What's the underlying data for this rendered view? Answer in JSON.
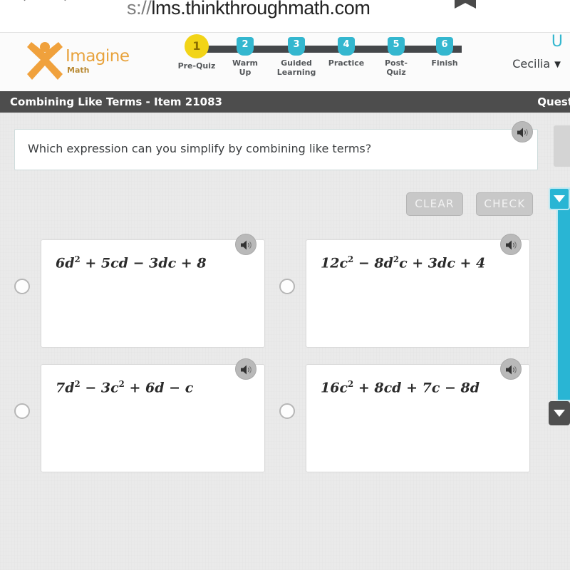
{
  "browser": {
    "url_dim": "s://",
    "url_main": "lms.thinkthroughmath.com",
    "left_glyphs": "← →",
    "bookmark_icon": "bookmark-icon"
  },
  "nav": {
    "logo_name": "Imagine",
    "logo_sub": "Math",
    "logo_icon": "imagine-math-x-logo",
    "user_initial": "U",
    "user_name": "Cecilia",
    "user_caret": "▼",
    "steps": [
      {
        "number": "1",
        "label": "Pre-Quiz",
        "state": "active"
      },
      {
        "number": "2",
        "label": "Warm Up",
        "state": "upcoming"
      },
      {
        "number": "3",
        "label": "Guided Learning",
        "state": "upcoming"
      },
      {
        "number": "4",
        "label": "Practice",
        "state": "upcoming"
      },
      {
        "number": "5",
        "label": "Post-Quiz",
        "state": "upcoming"
      },
      {
        "number": "6",
        "label": "Finish",
        "state": "upcoming"
      }
    ]
  },
  "title_bar": {
    "lesson_title": "Combining Like Terms - Item 21083",
    "question_counter": "Quest"
  },
  "question": {
    "prompt": "Which expression can you simplify by combining like terms?",
    "speaker_icon": "speaker-icon"
  },
  "actions": {
    "clear_label": "CLEAR",
    "check_label": "CHECK",
    "disabled": true
  },
  "options": [
    {
      "id": "A",
      "expr_html": "6<i>d</i><sup>2</sup> + 5<i>cd</i> − 3<i>dc</i> + 8",
      "expr_text": "6d^2 + 5cd - 3dc + 8",
      "selected": false
    },
    {
      "id": "B",
      "expr_html": "12<i>c</i><sup>2</sup> − 8<i>d</i><sup>2</sup><i>c</i> + 3<i>dc</i> + 4",
      "expr_text": "12c^2 - 8d^2c + 3dc + 4",
      "selected": false
    },
    {
      "id": "C",
      "expr_html": "7<i>d</i><sup>2</sup> − 3<i>c</i><sup>2</sup> + 6<i>d</i> − <i>c</i>",
      "expr_text": "7d^2 - 3c^2 + 6d - c",
      "selected": false
    },
    {
      "id": "D",
      "expr_html": "16<i>c</i><sup>2</sup> + 8<i>cd</i> + 7<i>c</i> − 8<i>d</i>",
      "expr_text": "16c^2 + 8cd + 7c - 8d",
      "selected": false
    }
  ],
  "rail": {
    "scroll_up_icon": "triangle-down-icon",
    "scroll_down_icon": "triangle-down-icon"
  },
  "colors": {
    "brand_orange": "#e8a33d",
    "accent_cyan": "#34b7cf",
    "active_yellow": "#f2d417",
    "title_bar": "#4d4d4d",
    "page_bg": "#eaeaea"
  }
}
